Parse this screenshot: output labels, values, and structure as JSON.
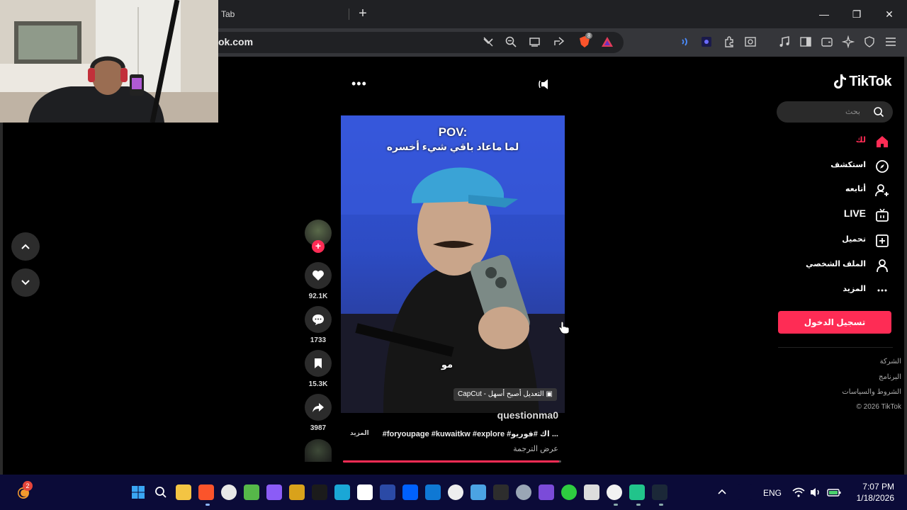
{
  "browser": {
    "tab_title": "Tab",
    "new_tab": "+",
    "url": "ok.com",
    "brave_count": "8",
    "controls": {
      "minimize": "—",
      "maximize": "❐",
      "close": "✕"
    }
  },
  "video": {
    "more": "•••",
    "overlay_title": "POV:",
    "overlay_subtitle": "لما ماعاد باقي شيء أخسره",
    "in_video_text": "مو",
    "capcut": "CapCut - التعديل أصبح أسهل",
    "author": "questionma0",
    "caption": "#foryoupage #kuwaitkw #explore #اك #فوريو ...",
    "caption_more": "المزيد",
    "translate": "عرض الترجمة",
    "progress": 0.99,
    "actions": {
      "follow": "+",
      "likes": "92.1K",
      "comments": "1733",
      "saves": "15.3K",
      "shares": "3987"
    }
  },
  "sidebar": {
    "logo": "TikTok",
    "search_placeholder": "بحث",
    "nav": [
      {
        "label": "لك",
        "icon": "home-icon",
        "active": true
      },
      {
        "label": "استكشف",
        "icon": "compass-icon"
      },
      {
        "label": "أتابعه",
        "icon": "user-plus-icon"
      },
      {
        "label": "LIVE",
        "icon": "live-tv-icon"
      },
      {
        "label": "تحميل",
        "icon": "upload-icon"
      },
      {
        "label": "الملف الشخصي",
        "icon": "profile-icon"
      },
      {
        "label": "المزيد",
        "icon": "more-icon"
      }
    ],
    "login": "تسجيل الدخول",
    "footer": [
      "الشركة",
      "البرنامج",
      "الشروط والسياسات",
      "© 2026 TikTok"
    ]
  },
  "taskbar": {
    "widget_badge": "2",
    "language": "ENG",
    "time": "7:07 PM",
    "date": "1/18/2026"
  },
  "colors": {
    "accent": "#fe2c55",
    "taskbar": "#0b0b38",
    "chrome": "#35363a"
  }
}
